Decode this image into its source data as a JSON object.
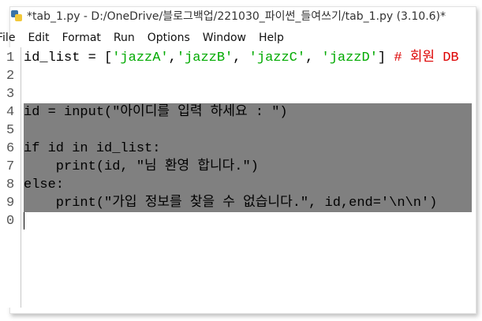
{
  "window": {
    "title": "*tab_1.py - D:/OneDrive/블로그백업/221030_파이썬_들여쓰기/tab_1.py (3.10.6)*"
  },
  "menu": [
    "File",
    "Edit",
    "Format",
    "Run",
    "Options",
    "Window",
    "Help"
  ],
  "line_numbers": [
    "1",
    "2",
    "3",
    "4",
    "5",
    "6",
    "7",
    "8",
    "9",
    "0"
  ],
  "code": {
    "l1_pre": "id_list = [",
    "l1_s1": "'jazzA'",
    "l1_c1": ",",
    "l1_s2": "'jazzB'",
    "l1_c2": ", ",
    "l1_s3": "'jazzC'",
    "l1_c3": ", ",
    "l1_s4": "'jazzD'",
    "l1_end": "] ",
    "l1_comment": "# 회원 DB",
    "l4": "id = input(\"아이디를 입력 하세요 : \")",
    "l6": "if id in id_list:",
    "l7": "    print(id, \"님 환영 합니다.\")",
    "l8": "else:",
    "l9": "    print(\"가입 정보를 찾을 수 없습니다.\", id,end='\\n\\n')"
  }
}
